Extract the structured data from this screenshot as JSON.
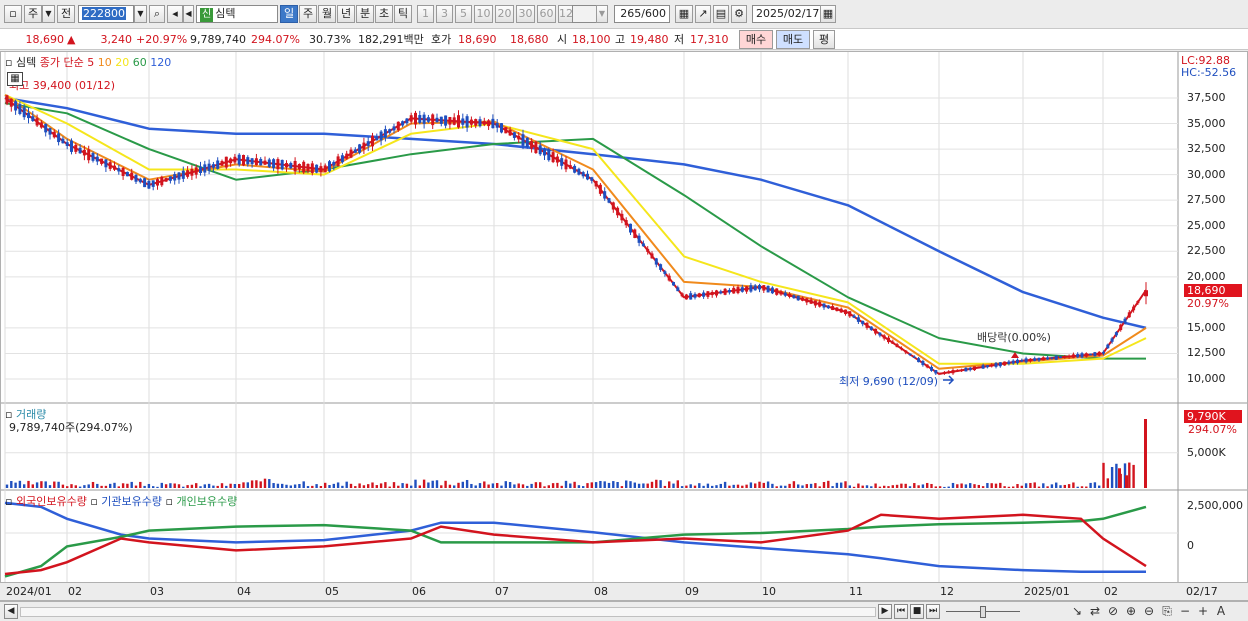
{
  "toolbar": {
    "market_label": "주",
    "all_label": "전",
    "stock_code": "222800",
    "new_badge": "신",
    "stock_name": "심텍",
    "periods": [
      "일",
      "주",
      "월",
      "년",
      "분",
      "초",
      "틱"
    ],
    "active_period": "일",
    "intervals": [
      "1",
      "3",
      "5",
      "10",
      "20",
      "30",
      "60",
      "120"
    ],
    "count_value": "265",
    "count_total": "/600",
    "date_value": "2025/02/17"
  },
  "quote": {
    "price": "18,690",
    "direction": "▲",
    "change": "3,240",
    "change_pct": "+20.97%",
    "volume": "9,789,740",
    "volume_pct": "294.07%",
    "turnover_pct": "30.73%",
    "amount": "182,291백만",
    "ask_label": "호가",
    "ask": "18,690",
    "bid": "18,680",
    "open_label": "시",
    "open": "18,100",
    "high_label": "고",
    "high": "19,480",
    "low_label": "저",
    "low": "17,310",
    "buy_label": "매수",
    "sell_label": "매도",
    "eval_label": "평"
  },
  "price_pane": {
    "title": "심텍",
    "ma_prefix": "종가 단순",
    "ma_periods": [
      "5",
      "10",
      "20",
      "60",
      "120"
    ],
    "max_label": "최고 39,400 (01/12)",
    "min_label": "최저 9,690 (12/09)",
    "dividend_label": "배당락(0.00%)",
    "lc_label": "LC:92.88",
    "hc_label": "HC:-52.56",
    "current_price_tag": "18,690",
    "current_pct_tag": "20.97%",
    "yticks": [
      "37,500",
      "35,000",
      "32,500",
      "30,000",
      "27,500",
      "25,000",
      "22,500",
      "20,000",
      "15,000",
      "12,500",
      "10,000"
    ]
  },
  "volume_pane": {
    "title": "거래량",
    "value_label": "9,789,740주(294.07%)",
    "tag_value": "9,790K",
    "tag_pct": "294.07%",
    "ytick": "5,000K"
  },
  "holdings_pane": {
    "legend": [
      "외국인보유수량",
      "기관보유수량",
      "개인보유수량"
    ],
    "yticks": [
      "2,500,000",
      "0"
    ]
  },
  "xaxis": {
    "labels": [
      "2024/01",
      "02",
      "03",
      "04",
      "05",
      "06",
      "07",
      "08",
      "09",
      "10",
      "11",
      "12",
      "2025/01",
      "02"
    ],
    "right_label": "02/17"
  },
  "colors": {
    "up": "#d2141e",
    "down": "#1f4fbf",
    "ma5": "#d2141e",
    "ma10": "#f08a1c",
    "ma20": "#f5e61c",
    "ma60": "#2a9a48",
    "ma120": "#2f5fd8",
    "foreign": "#d2141e",
    "institution": "#2f5fd8",
    "individual": "#2a9a48"
  },
  "chart_data": [
    {
      "type": "line",
      "title": "심텍",
      "x": [
        "2024/01",
        "02",
        "03",
        "04",
        "05",
        "06",
        "07",
        "08",
        "09",
        "10",
        "11",
        "12",
        "2025/01",
        "02",
        "02/17"
      ],
      "series": [
        {
          "name": "5",
          "values": [
            37500,
            33000,
            29000,
            31500,
            30500,
            35500,
            35000,
            29500,
            18000,
            19000,
            16500,
            10500,
            11800,
            12500,
            18690
          ]
        },
        {
          "name": "10",
          "values": [
            37800,
            33500,
            29500,
            31000,
            30300,
            35000,
            35200,
            30500,
            19500,
            19000,
            17000,
            11000,
            11700,
            12300,
            15000
          ]
        },
        {
          "name": "20",
          "values": [
            37800,
            35000,
            30500,
            30500,
            30000,
            34000,
            35000,
            32500,
            22000,
            19500,
            17500,
            11500,
            11500,
            12000,
            14000
          ]
        },
        {
          "name": "60",
          "values": [
            37000,
            36000,
            32500,
            29500,
            30500,
            32000,
            33000,
            33500,
            28000,
            23000,
            18000,
            14000,
            12500,
            12000,
            12000
          ]
        },
        {
          "name": "120",
          "values": [
            37500,
            36500,
            34500,
            34000,
            34000,
            33500,
            33000,
            32000,
            31000,
            29500,
            27000,
            22500,
            18500,
            16000,
            15000
          ]
        }
      ],
      "ylim": [
        8000,
        40000
      ]
    },
    {
      "type": "bar",
      "title": "거래량",
      "categories": [
        "2024/01",
        "02",
        "03",
        "04",
        "05",
        "06",
        "07",
        "08",
        "09",
        "10",
        "11",
        "12",
        "2025/01",
        "02",
        "02/17"
      ],
      "values": [
        700,
        600,
        500,
        900,
        600,
        1000,
        700,
        800,
        600,
        700,
        500,
        500,
        600,
        2500,
        9790
      ],
      "ylabel": "K"
    }
  ]
}
